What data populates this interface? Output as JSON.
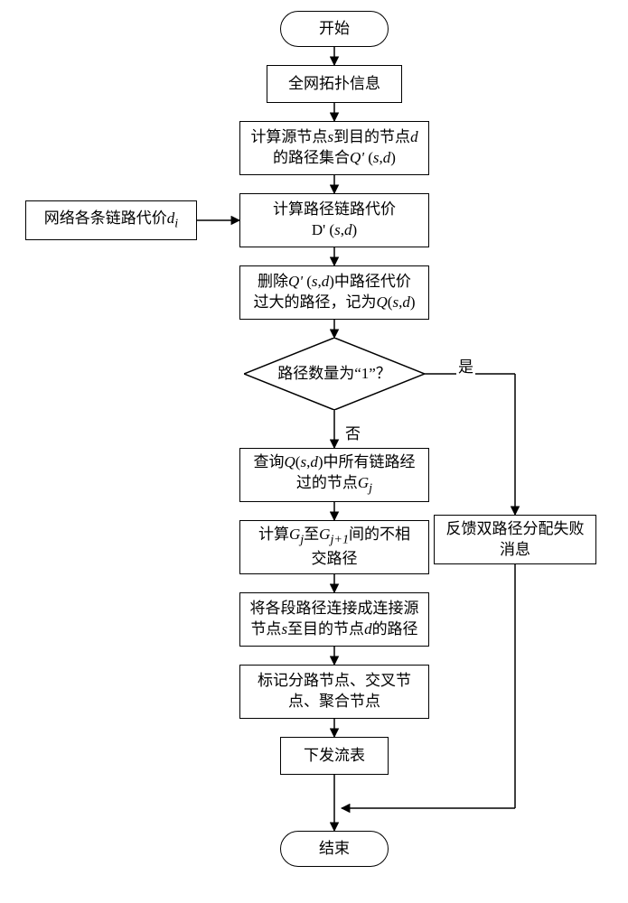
{
  "flowchart": {
    "start": "开始",
    "end": "结束",
    "step1": "全网拓扑信息",
    "step2_line1": "计算源节点<i>s</i>到目的节点<i>d</i>",
    "step2_line2": "的路径集合<i>Q'</i> (<i>s</i>,<i>d</i>)",
    "side_input": "网络各条链路代价<i>d<sub>i</sub></i>",
    "step3_line1": "计算路径链路代价",
    "step3_line2": "D' (<i>s</i>,<i>d</i>)",
    "step4_line1": "删除<i>Q'</i> (<i>s</i>,<i>d</i>)中路径代价",
    "step4_line2": "过大的路径，记为<i>Q</i>(<i>s</i>,<i>d</i>)",
    "decision": "路径数量为“1”？",
    "yes": "是",
    "no": "否",
    "step5_line1": "查询<i>Q</i>(<i>s</i>,<i>d</i>)中所有链路经",
    "step5_line2": "过的节点<i>G<sub>j</sub></i>",
    "step6_line1": "计算<i>G<sub>j</sub></i>至<i>G<sub>j+1</sub></i>间的不相",
    "step6_line2": "交路径",
    "step7_line1": "将各段路径连接成连接源",
    "step7_line2": "节点<i>s</i>至目的节点<i>d</i>的路径",
    "step8_line1": "标记分路节点、交叉节",
    "step8_line2": "点、聚合节点",
    "step9": "下发流表",
    "feedback": "反馈双路径分配失败消息"
  }
}
